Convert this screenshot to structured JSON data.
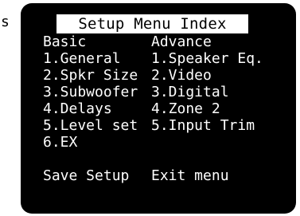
{
  "edge_glyph": "s",
  "title": "Setup Menu Index",
  "columns": {
    "left_header": "Basic",
    "right_header": "Advance"
  },
  "basic_items": [
    "1.General",
    "2.Spkr Size",
    "3.Subwoofer",
    "4.Delays",
    "5.Level set",
    "6.EX"
  ],
  "advance_items": [
    "1.Speaker Eq.",
    "2.Video",
    "3.Digital",
    "4.Zone 2",
    "5.Input Trim"
  ],
  "actions": {
    "save": "Save Setup",
    "exit": "Exit menu"
  },
  "colors": {
    "screen_background": "#000000",
    "text": "#ffffff",
    "title_background": "#ffffff",
    "title_text": "#000000"
  }
}
